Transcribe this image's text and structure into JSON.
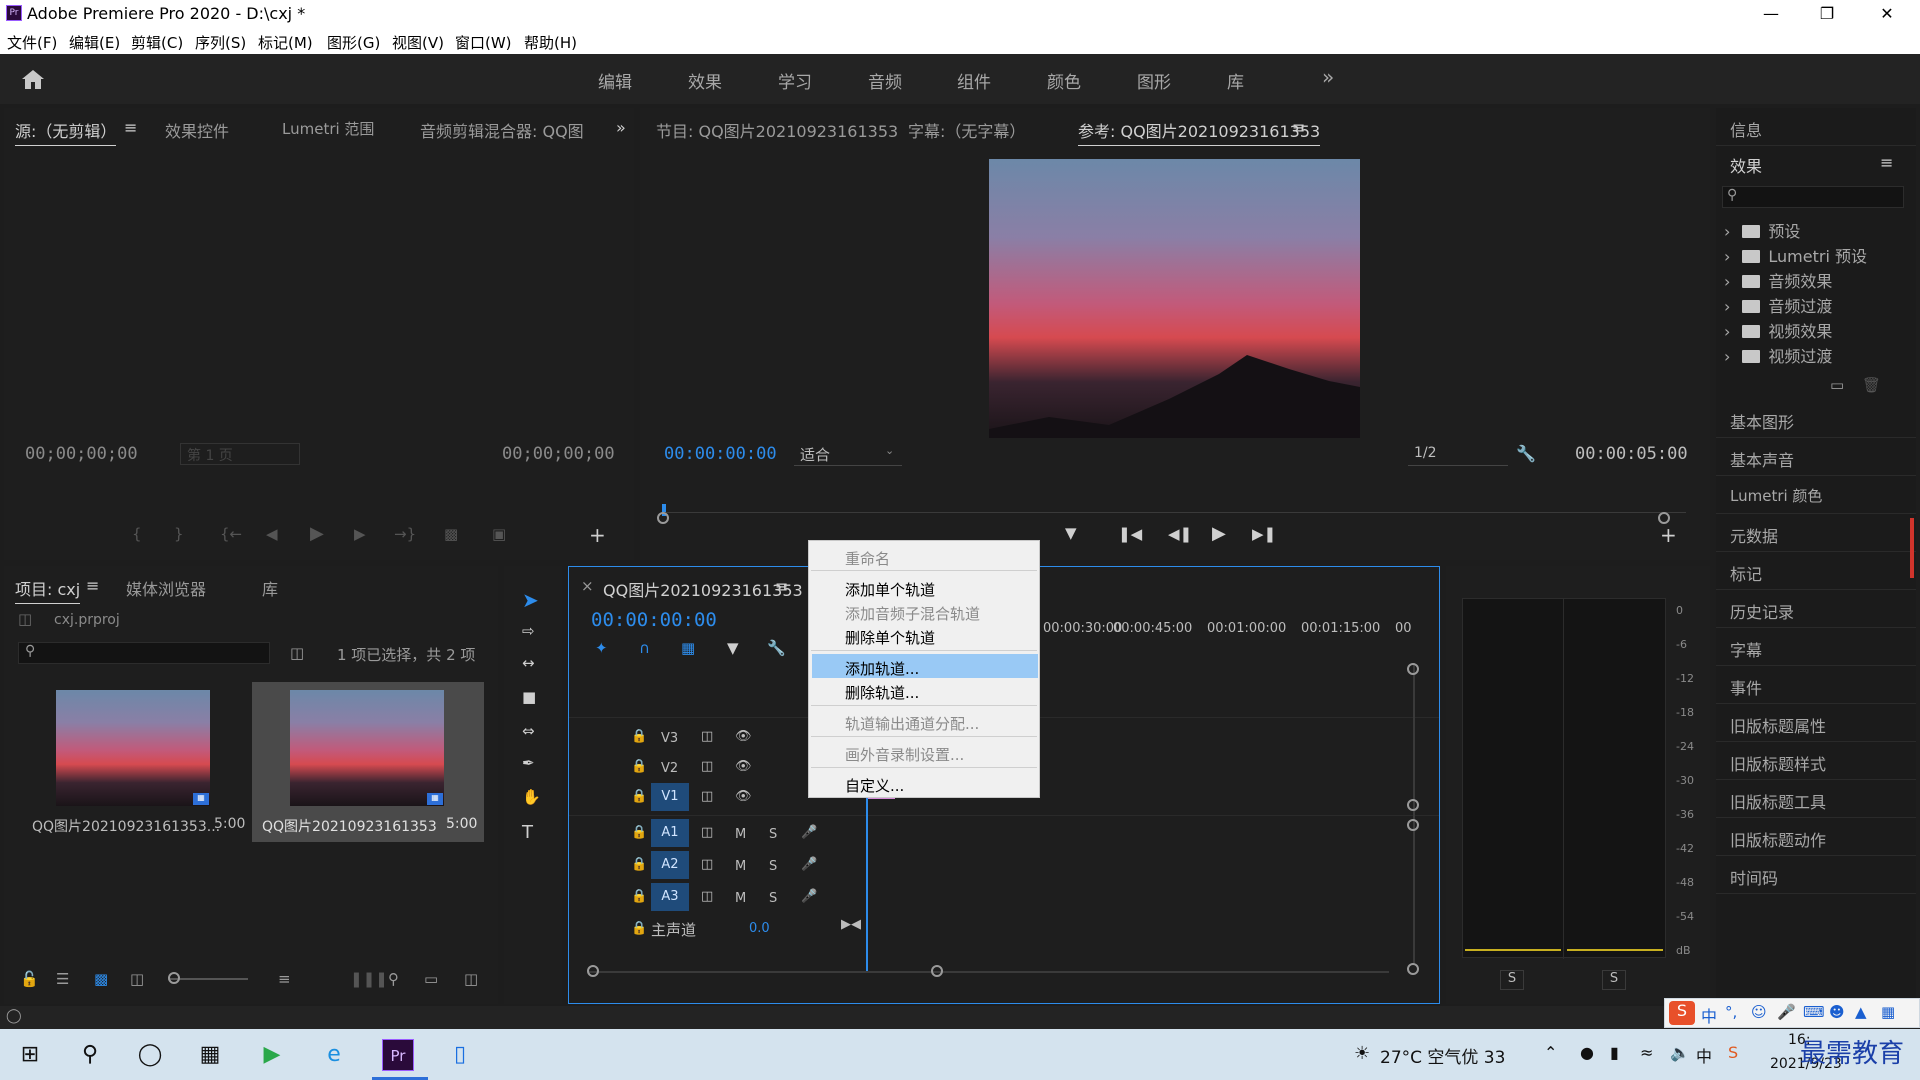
{
  "window": {
    "title": "Adobe Premiere Pro 2020 - D:\\cxj *",
    "min_icon": "minimize-icon",
    "max_icon": "restore-icon",
    "close_icon": "close-icon"
  },
  "menu": [
    "文件(F)",
    "编辑(E)",
    "剪辑(C)",
    "序列(S)",
    "标记(M)",
    "图形(G)",
    "视图(V)",
    "窗口(W)",
    "帮助(H)"
  ],
  "workspaces": [
    "编辑",
    "效果",
    "学习",
    "音频",
    "组件",
    "颜色",
    "图形",
    "库"
  ],
  "source_panel": {
    "tabs": [
      "源:（无剪辑）",
      "效果控件",
      "Lumetri 范围",
      "音频剪辑混合器: QQ图"
    ],
    "tc_left": "00;00;00;00",
    "tc_right": "00;00;00;00",
    "page": "第 1 页"
  },
  "program_panel": {
    "tabs": [
      "节目: QQ图片20210923161353",
      "字幕:（无字幕）",
      "参考: QQ图片20210923161353"
    ],
    "tc_current": "00:00:00:00",
    "fit": "适合",
    "ratio": "1/2",
    "tc_duration": "00:00:05:00"
  },
  "right_panel": {
    "info": "信息",
    "effects_title": "效果",
    "effects_items": [
      "预设",
      "Lumetri 预设",
      "音频效果",
      "音频过渡",
      "视频效果",
      "视频过渡"
    ],
    "items": [
      "基本图形",
      "基本声音",
      "Lumetri 颜色",
      "元数据",
      "标记",
      "历史记录",
      "字幕",
      "事件",
      "旧版标题属性",
      "旧版标题样式",
      "旧版标题工具",
      "旧版标题动作",
      "时间码"
    ]
  },
  "project_panel": {
    "tabs": [
      "项目: cxj",
      "媒体浏览器",
      "库"
    ],
    "file": "cxj.prproj",
    "selection": "1 项已选择，共 2 项",
    "thumbs": [
      {
        "name": "QQ图片20210923161353...",
        "dur": "5:00"
      },
      {
        "name": "QQ图片20210923161353",
        "dur": "5:00"
      }
    ]
  },
  "timeline": {
    "tab": "QQ图片20210923161353",
    "tc": "00:00:00:00",
    "ruler": [
      "00:00:30:00",
      "00:00:45:00",
      "00:01:00:00",
      "00:01:15:00",
      "00"
    ],
    "video_tracks": [
      "V3",
      "V2",
      "V1"
    ],
    "audio_tracks": [
      "A1",
      "A2",
      "A3"
    ],
    "master": "主声道",
    "master_val": "0.0",
    "m": "M",
    "s": "S"
  },
  "context_menu": {
    "items": [
      {
        "label": "重命名",
        "disabled": true
      },
      {
        "label": "添加单个轨道",
        "disabled": false
      },
      {
        "label": "添加音频子混合轨道",
        "disabled": true
      },
      {
        "label": "删除单个轨道",
        "disabled": false
      },
      {
        "label": "添加轨道...",
        "disabled": false,
        "highlight": true
      },
      {
        "label": "删除轨道...",
        "disabled": false
      },
      {
        "label": "轨道输出通道分配...",
        "disabled": true
      },
      {
        "label": "画外音录制设置...",
        "disabled": true
      },
      {
        "label": "自定义...",
        "disabled": false
      }
    ]
  },
  "audio_meter": {
    "scale": [
      "0",
      "-6",
      "-12",
      "-18",
      "-24",
      "-30",
      "-36",
      "-42",
      "-48",
      "-54",
      "dB"
    ],
    "solo": [
      "S",
      "S"
    ]
  },
  "taskbar": {
    "weather": "27°C 空气优 33",
    "ime": "中",
    "date": "2021/9/23",
    "time": "16:",
    "watermark": "最需教育"
  },
  "colors": {
    "accent": "#2d8ceb",
    "highlight": "#99c9f5",
    "track": "#1f4b7a"
  }
}
